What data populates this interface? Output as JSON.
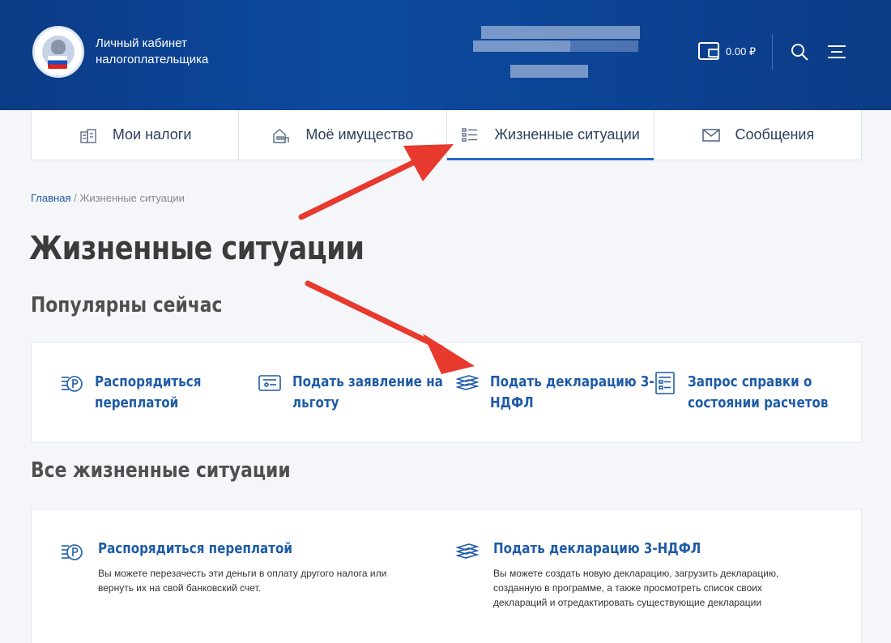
{
  "header": {
    "title_line1": "Личный кабинет",
    "title_line2": "налогоплательщика",
    "balance": "0.00 ₽"
  },
  "tabs": [
    {
      "label": "Мои налоги"
    },
    {
      "label": "Моё имущество"
    },
    {
      "label": "Жизненные ситуации",
      "active": true
    },
    {
      "label": "Сообщения"
    }
  ],
  "breadcrumb": {
    "home": "Главная",
    "separator": " / ",
    "current": "Жизненные ситуации"
  },
  "page_title": "Жизненные ситуации",
  "popular": {
    "title": "Популярны сейчас",
    "items": [
      {
        "label_line1": "Распорядиться",
        "label_line2": "переплатой"
      },
      {
        "label_line1": "Подать заявление на",
        "label_line2": "льготу"
      },
      {
        "label_line1": "Подать декларацию 3-",
        "label_line2": "НДФЛ"
      },
      {
        "label_line1": "Запрос справки о",
        "label_line2": "состоянии расчетов"
      }
    ]
  },
  "all": {
    "title": "Все жизненные ситуации",
    "items": [
      {
        "label": "Распорядиться переплатой",
        "desc": "Вы можете перезачесть эти деньги в оплату другого налога или вернуть их на свой банковский счет."
      },
      {
        "label": "Подать декларацию 3-НДФЛ",
        "desc": "Вы можете создать новую декларацию, загрузить декларацию, созданную в программе, а также просмотреть список своих деклараций и отредактировать существующие декларации"
      }
    ]
  },
  "colors": {
    "header": "#0d4aa0",
    "accent": "#1f5ba8",
    "arrow": "#e8392e"
  }
}
